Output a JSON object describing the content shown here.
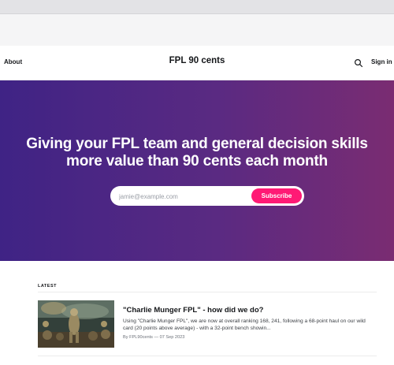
{
  "header": {
    "nav_about": "About",
    "site_title": "FPL 90 cents",
    "signin_label": "Sign in",
    "search_icon": "search-icon"
  },
  "hero": {
    "headline_line1": "Giving your FPL team and general decision skills",
    "headline_line2": "more value than 90 cents each month",
    "email_placeholder": "jamie@example.com",
    "subscribe_label": "Subscribe",
    "gradient_start": "#3f2385",
    "gradient_end": "#7a2c72",
    "button_color": "#ff1a75"
  },
  "latest": {
    "section_label": "LATEST",
    "posts": [
      {
        "title": "\"Charlie Munger FPL\" - how did we do?",
        "excerpt": "Using \"Charlie Munger FPL\", we are now at overall ranking 168, 241, following a 68-point haul on our wild card (20 points above average) - with a 32-point bench showin...",
        "meta": "By FPL90cents — 07 Sep 2023"
      }
    ]
  }
}
